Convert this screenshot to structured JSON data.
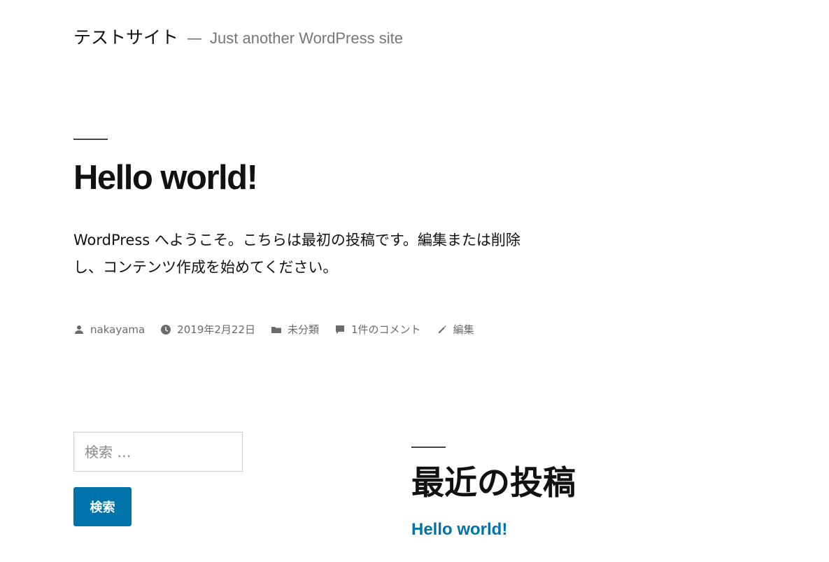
{
  "header": {
    "site_title": "テストサイト",
    "separator": "—",
    "tagline": "Just another WordPress site"
  },
  "post": {
    "title": "Hello world!",
    "content_line1": "WordPress へようこそ。こちらは最初の投稿です。編集または削除",
    "content_line2": "し、コンテンツ作成を始めてください。",
    "meta": {
      "author": "nakayama",
      "date": "2019年2月22日",
      "category": "未分類",
      "comments": "1件のコメント",
      "edit": "編集"
    }
  },
  "search": {
    "placeholder": "検索 …",
    "button_label": "検索"
  },
  "recent_posts": {
    "title": "最近の投稿",
    "items": [
      "Hello world!"
    ]
  },
  "colors": {
    "link": "#0073aa",
    "meta_text": "#6b6b6b",
    "button_bg": "#0073aa"
  }
}
